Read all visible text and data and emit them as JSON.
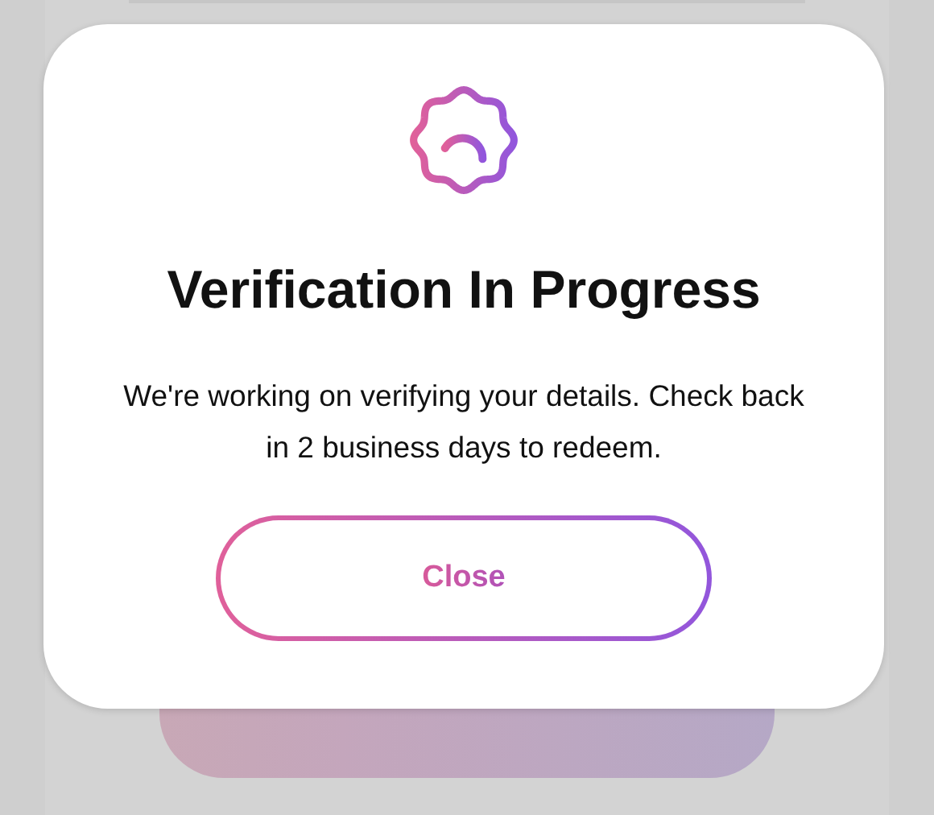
{
  "dialog": {
    "title": "Verification In Progress",
    "message": "We're working on verifying your details. Check back in 2 business days to redeem.",
    "button": "Close"
  }
}
